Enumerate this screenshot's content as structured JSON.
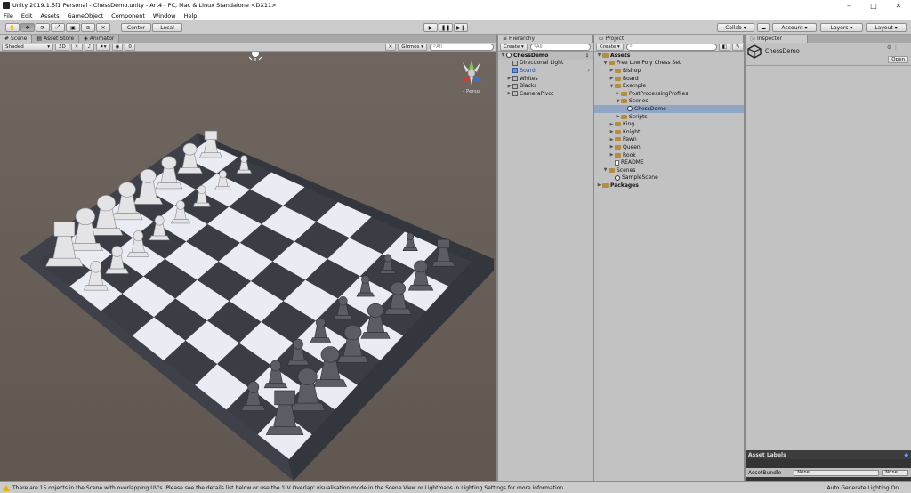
{
  "window": {
    "title": "Unity 2019.1.5f1 Personal - ChessDemo.unity - Art4 - PC, Mac & Linux Standalone <DX11>",
    "minimize": "–",
    "maximize": "□",
    "close": "✕"
  },
  "menu": [
    "File",
    "Edit",
    "Assets",
    "GameObject",
    "Component",
    "Window",
    "Help"
  ],
  "toolbar": {
    "pivot": "Center",
    "space": "Local",
    "collab": "Collab ▾",
    "account": "Account ▾",
    "layers": "Layers ▾",
    "layout": "Layout ▾"
  },
  "scene_tabs": [
    "Scene",
    "Asset Store",
    "Animator"
  ],
  "scene_bar": {
    "shading": "Shaded",
    "mode_2d": "2D",
    "audio_count": "0",
    "gizmos": "Gizmos ▾",
    "search_placeholder": "All",
    "persp": "Persp"
  },
  "hierarchy": {
    "tab": "Hierarchy",
    "create": "Create ▾",
    "search_placeholder": "All",
    "scene": "ChessDemo",
    "items": [
      "Directional Light",
      "Board",
      "Whites",
      "Blacks",
      "CameraPivot"
    ]
  },
  "project": {
    "tab": "Project",
    "create": "Create ▾",
    "root": "Assets",
    "tree": [
      {
        "label": "Free Low Poly Chess Set",
        "depth": 1,
        "open": true,
        "type": "folder"
      },
      {
        "label": "Bishop",
        "depth": 2,
        "open": false,
        "type": "folder"
      },
      {
        "label": "Board",
        "depth": 2,
        "open": false,
        "type": "folder"
      },
      {
        "label": "Example",
        "depth": 2,
        "open": true,
        "type": "folder"
      },
      {
        "label": "PostProcessingProfiles",
        "depth": 3,
        "open": false,
        "type": "folder"
      },
      {
        "label": "Scenes",
        "depth": 3,
        "open": true,
        "type": "folder"
      },
      {
        "label": "ChessDemo",
        "depth": 4,
        "open": null,
        "type": "scene",
        "selected": true
      },
      {
        "label": "Scripts",
        "depth": 3,
        "open": false,
        "type": "folder"
      },
      {
        "label": "King",
        "depth": 2,
        "open": false,
        "type": "folder"
      },
      {
        "label": "Knight",
        "depth": 2,
        "open": false,
        "type": "folder"
      },
      {
        "label": "Pawn",
        "depth": 2,
        "open": false,
        "type": "folder"
      },
      {
        "label": "Queen",
        "depth": 2,
        "open": false,
        "type": "folder"
      },
      {
        "label": "Rook",
        "depth": 2,
        "open": false,
        "type": "folder"
      },
      {
        "label": "README",
        "depth": 2,
        "open": null,
        "type": "readme"
      },
      {
        "label": "Scenes",
        "depth": 1,
        "open": true,
        "type": "folder"
      },
      {
        "label": "SampleScene",
        "depth": 2,
        "open": null,
        "type": "scene"
      },
      {
        "label": "Packages",
        "depth": 0,
        "open": false,
        "type": "folder",
        "bold": true
      }
    ]
  },
  "inspector": {
    "tab": "Inspector",
    "object_name": "ChessDemo",
    "open_button": "Open",
    "asset_labels": "Asset Labels",
    "asset_bundle_label": "AssetBundle",
    "asset_bundle_value": "None",
    "asset_variant_value": "None"
  },
  "status": {
    "message": "There are 15 objects in the Scene with overlapping UV's. Please see the details list below or use the 'UV Overlap' visualisation mode in the Scene View or Lightmaps in Lighting Settings for more information.",
    "right": "Auto Generate Lighting On"
  }
}
